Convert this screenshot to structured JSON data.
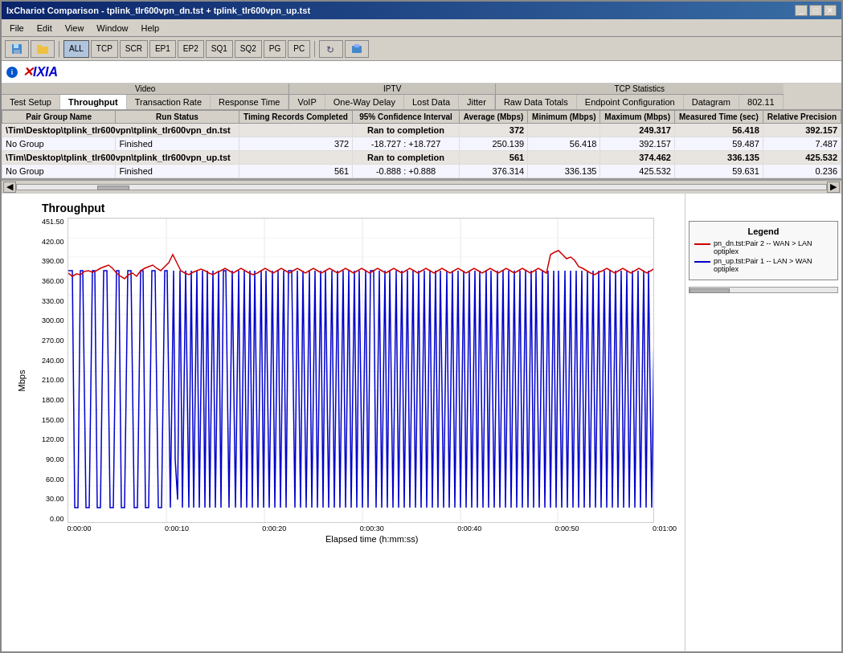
{
  "window": {
    "title": "IxChariot Comparison - tplink_tlr600vpn_dn.tst + tplink_tlr600vpn_up.tst"
  },
  "menu": {
    "items": [
      "File",
      "Edit",
      "View",
      "Window",
      "Help"
    ]
  },
  "toolbar": {
    "buttons": [
      "ALL",
      "TCP",
      "SCR",
      "EP1",
      "EP2",
      "SQ1",
      "SQ2",
      "PG",
      "PC"
    ]
  },
  "logo": {
    "prefix": "i",
    "brand": "XIXIA"
  },
  "tab_groups": [
    {
      "label": "Video",
      "tabs": [
        "Test Setup",
        "Throughput",
        "Transaction Rate",
        "Response Time"
      ]
    },
    {
      "label": "IPTV",
      "tabs": [
        "VoIP",
        "One-Way Delay",
        "Lost Data",
        "Jitter"
      ]
    },
    {
      "label": "TCP Statistics",
      "tabs": [
        "Raw Data Totals",
        "Endpoint Configuration",
        "Datagram",
        "802.11"
      ]
    }
  ],
  "table": {
    "headers": {
      "pair_group_name": "Pair Group Name",
      "run_status": "Run Status",
      "timing_records": "Timing Records Completed",
      "confidence": "95% Confidence Interval",
      "average": "Average (Mbps)",
      "minimum": "Minimum (Mbps)",
      "maximum": "Maximum (Mbps)",
      "measured_time": "Measured Time (sec)",
      "relative_precision": "Relative Precision"
    },
    "rows": [
      {
        "type": "file",
        "file": "\\Tim\\Desktop\\tplink_tlr600vpn\\tplink_tlr600vpn_dn.tst",
        "status": "Ran to completion",
        "records": "372",
        "avg": "249.317",
        "min": "56.418",
        "max": "392.157"
      },
      {
        "type": "group",
        "group": "No Group",
        "status": "Finished",
        "records": "372",
        "confidence": "-18.727 : +18.727",
        "avg": "250.139",
        "min": "56.418",
        "max": "392.157",
        "time": "59.487",
        "precision": "7.487"
      },
      {
        "type": "file",
        "file": "\\Tim\\Desktop\\tplink_tlr600vpn\\tplink_tlr600vpn_up.tst",
        "status": "Ran to completion",
        "records": "561",
        "avg": "374.462",
        "min": "336.135",
        "max": "425.532"
      },
      {
        "type": "group",
        "group": "No Group",
        "status": "Finished",
        "records": "561",
        "confidence": "-0.888 : +0.888",
        "avg": "376.314",
        "min": "336.135",
        "max": "425.532",
        "time": "59.631",
        "precision": "0.236"
      }
    ]
  },
  "chart": {
    "title": "Throughput",
    "y_label": "Mbps",
    "x_label": "Elapsed time (h:mm:ss)",
    "y_axis": [
      "451.50",
      "420.00",
      "390.00",
      "360.00",
      "330.00",
      "300.00",
      "270.00",
      "240.00",
      "210.00",
      "180.00",
      "150.00",
      "120.00",
      "90.00",
      "60.00",
      "30.00",
      "0.00"
    ],
    "x_axis": [
      "0:00:00",
      "0:00:10",
      "0:00:20",
      "0:00:30",
      "0:00:40",
      "0:00:50",
      "0:01:00"
    ]
  },
  "legend": {
    "title": "Legend",
    "items": [
      {
        "color": "#cc0000",
        "label": "pn_dn.tst:Pair 2 -- WAN > LAN optiplex"
      },
      {
        "color": "#0000cc",
        "label": "pn_up.tst:Pair 1 -- LAN > WAN optiplex"
      }
    ]
  }
}
